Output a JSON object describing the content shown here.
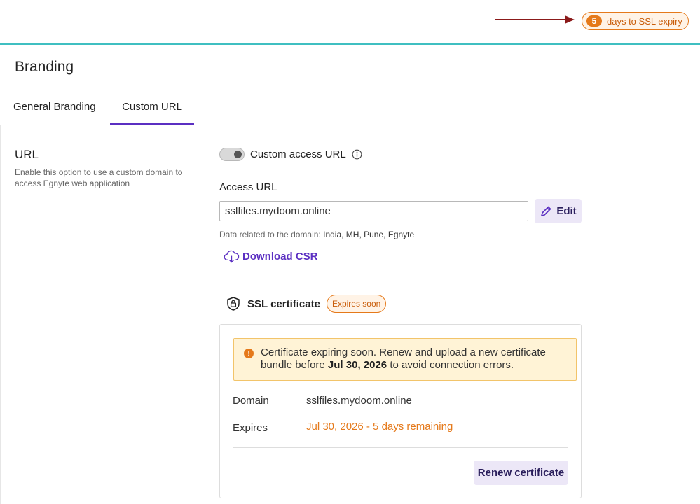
{
  "topbar": {
    "ssl_days": "5",
    "ssl_text": "days to SSL expiry"
  },
  "page": {
    "title": "Branding"
  },
  "tabs": [
    {
      "label": "General Branding",
      "active": false
    },
    {
      "label": "Custom URL",
      "active": true
    }
  ],
  "url_section": {
    "title": "URL",
    "description": "Enable this option to use a custom domain to access Egnyte web application",
    "toggle_label": "Custom access URL",
    "toggle_on": true,
    "access_url_label": "Access URL",
    "access_url_value": "sslfiles.mydoom.online",
    "edit_label": "Edit",
    "domain_note_label": "Data related to the domain:",
    "domain_note_value": "India, MH, Pune, Egnyte",
    "download_csr_label": "Download CSR"
  },
  "ssl": {
    "title": "SSL certificate",
    "badge": "Expires soon",
    "warning_prefix": "Certificate expiring soon. Renew and upload a new certificate bundle before ",
    "warning_date": "Jul 30, 2026",
    "warning_suffix": " to avoid connection errors.",
    "domain_label": "Domain",
    "domain_value": "sslfiles.mydoom.online",
    "expires_label": "Expires",
    "expires_value": "Jul 30, 2026 - 5 days remaining",
    "renew_label": "Renew certificate"
  },
  "colors": {
    "accent": "#5b2fc2",
    "warning": "#e5791a",
    "topbar_border": "#3fbfc1",
    "arrow": "#8b1a1a"
  },
  "icons": [
    "arrow-right-icon",
    "info-icon",
    "pencil-icon",
    "cloud-download-icon",
    "shield-lock-icon",
    "warning-icon"
  ]
}
